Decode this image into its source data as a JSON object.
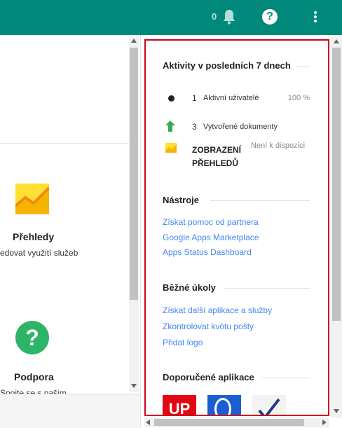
{
  "header": {
    "notification_count": "0",
    "icons": [
      "bell-icon",
      "help-icon",
      "more-vert-icon"
    ],
    "help_glyph": "?"
  },
  "left": {
    "reports_title": "Přehledy",
    "reports_subtitle": "edovat využití služeb",
    "support_title": "Podpora",
    "support_subtitle": "Spojte se s našim",
    "support_glyph": "?"
  },
  "panel": {
    "activity": {
      "title": "Aktivity v posledních 7 dnech",
      "rows": [
        {
          "count": "1",
          "label": "Aktivní uživatelé",
          "value": "100 %"
        },
        {
          "count": "3",
          "label": "Vytvořené dokumenty"
        }
      ],
      "reports_link_line1": "ZOBRAZENÍ",
      "reports_link_line2": "PŘEHLEDŮ",
      "reports_status": "Není k dispozici"
    },
    "tools": {
      "title": "Nástroje",
      "links": [
        "Získat pomoc od partnera",
        "Google Apps Marketplace",
        "Apps Status Dashboard"
      ]
    },
    "common_tasks": {
      "title": "Běžné úkoly",
      "links": [
        "Získat další aplikace a služby",
        "Zkontrolovat kvótu pošty",
        "Přidat logo"
      ]
    },
    "recommended": {
      "title": "Doporučené aplikace",
      "app_logo_text": "UP",
      "apps": [
        "up-app-logo",
        "blue-o-app-logo",
        "checkmark-app-logo"
      ]
    }
  },
  "colors": {
    "header_bg": "#00897b",
    "accent_link": "#4285f4",
    "panel_border": "#d0021b",
    "support_green": "#2db567"
  }
}
